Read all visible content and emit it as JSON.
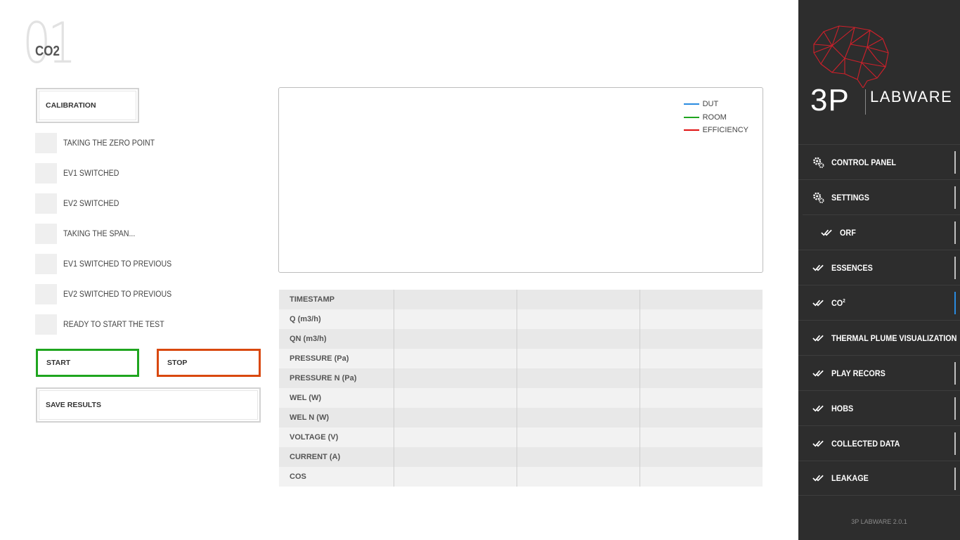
{
  "header": {
    "page_number": "01",
    "title": "CO2"
  },
  "controls": {
    "calibration_label": "CALIBRATION",
    "start_label": "START",
    "stop_label": "STOP",
    "save_label": "SAVE RESULTS",
    "steps": [
      "TAKING THE ZERO POINT",
      "EV1 SWITCHED",
      "EV2 SWITCHED",
      "TAKING THE SPAN...",
      "EV1 SWITCHED TO PREVIOUS",
      "EV2 SWITCHED TO PREVIOUS",
      "READY TO START THE TEST"
    ]
  },
  "chart": {
    "legend": [
      {
        "label": "DUT",
        "color": "#2a8be0"
      },
      {
        "label": "ROOM",
        "color": "#1fa51f"
      },
      {
        "label": "EFFICIENCY",
        "color": "#e01010"
      }
    ]
  },
  "table": {
    "rows": [
      "TIMESTAMP",
      "Q (m3/h)",
      "QN (m3/h)",
      "PRESSURE (Pa)",
      "PRESSURE N (Pa)",
      "WEL (W)",
      "WEL N (W)",
      "VOLTAGE (V)",
      "CURRENT (A)",
      "COS"
    ]
  },
  "sidebar": {
    "logo_main": "3P",
    "logo_sub": "LABWARE",
    "items": [
      {
        "label": "CONTROL PANEL",
        "icon": "gears-icon"
      },
      {
        "label": "SETTINGS",
        "icon": "gears-icon"
      },
      {
        "label": "ORF",
        "icon": "double-check-icon"
      },
      {
        "label": "ESSENCES",
        "icon": "double-check-icon"
      },
      {
        "label": "CO",
        "sup": "2",
        "icon": "double-check-icon"
      },
      {
        "label": "THERMAL PLUME VISUALIZATION",
        "icon": "double-check-icon"
      },
      {
        "label": "PLAY RECORS",
        "icon": "double-check-icon"
      },
      {
        "label": "HOBS",
        "icon": "double-check-icon"
      },
      {
        "label": "COLLECTED DATA",
        "icon": "double-check-icon"
      },
      {
        "label": "LEAKAGE",
        "icon": "double-check-icon"
      }
    ],
    "version": "3P LABWARE 2.0.1"
  }
}
